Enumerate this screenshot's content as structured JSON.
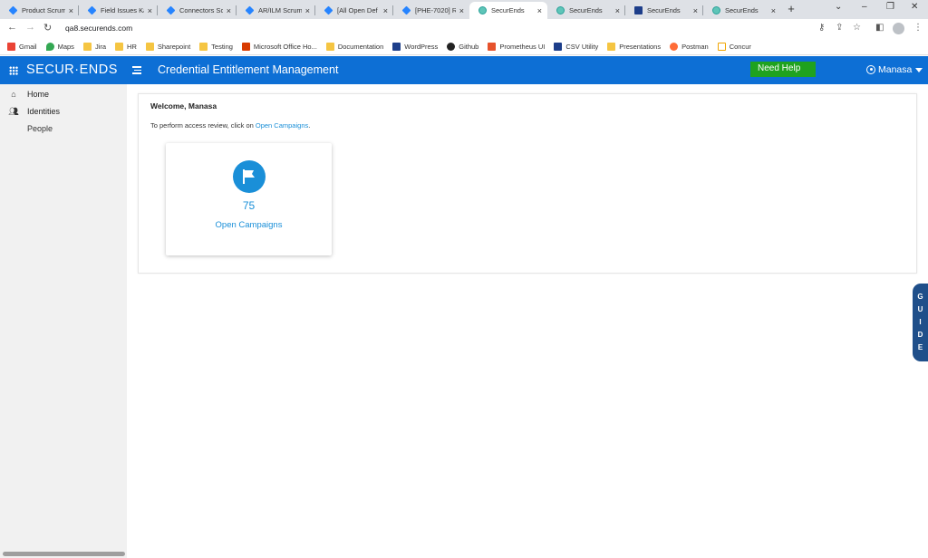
{
  "browser": {
    "tabs": [
      {
        "label": "Product Scrum",
        "favicon": "jira-icon",
        "active": false
      },
      {
        "label": "Field Issues Ka",
        "favicon": "jira-icon",
        "active": false
      },
      {
        "label": "Connectors Sc",
        "favicon": "jira-icon",
        "active": false
      },
      {
        "label": "AR/ILM Scrum",
        "favicon": "jira-icon",
        "active": false
      },
      {
        "label": "[All Open Def",
        "favicon": "jira-icon",
        "active": false
      },
      {
        "label": "[PHE-7020] Re",
        "favicon": "jira-icon",
        "active": false
      },
      {
        "label": "SecurEnds",
        "favicon": "securends-icon",
        "active": true
      },
      {
        "label": "SecurEnds",
        "favicon": "securends-icon",
        "active": false
      },
      {
        "label": "SecurEnds",
        "favicon": "securends-s-icon",
        "active": false
      },
      {
        "label": "SecurEnds",
        "favicon": "securends-icon",
        "active": false
      }
    ],
    "new_tab": "+",
    "close_glyph": "×",
    "window_controls": {
      "tab_search": "⌄",
      "minimize": "–",
      "restore": "❐",
      "close": "✕"
    },
    "url": "qa8.securends.com",
    "bookmarks": [
      {
        "label": "Gmail",
        "icon": "gmail-icon"
      },
      {
        "label": "Maps",
        "icon": "maps-icon"
      },
      {
        "label": "Jira",
        "icon": "folder-icon"
      },
      {
        "label": "HR",
        "icon": "folder-icon"
      },
      {
        "label": "Sharepoint",
        "icon": "folder-icon"
      },
      {
        "label": "Testing",
        "icon": "folder-icon"
      },
      {
        "label": "Microsoft Office Ho...",
        "icon": "office-icon"
      },
      {
        "label": "Documentation",
        "icon": "folder-icon"
      },
      {
        "label": "WordPress",
        "icon": "securends-s-icon"
      },
      {
        "label": "Github",
        "icon": "github-icon"
      },
      {
        "label": "Prometheus UI",
        "icon": "prometheus-icon"
      },
      {
        "label": "CSV Utility",
        "icon": "securends-s-icon"
      },
      {
        "label": "Presentations",
        "icon": "folder-icon"
      },
      {
        "label": "Postman",
        "icon": "postman-icon"
      },
      {
        "label": "Concur",
        "icon": "concur-icon"
      }
    ]
  },
  "app": {
    "logo": "SECUR·ENDS",
    "title": "Credential Entitlement Management",
    "need_help": "Need Help",
    "user_name": "Manasa",
    "colors": {
      "header": "#0d6fd5",
      "accent": "#1a8fd8",
      "help": "#1fa21f",
      "guide": "#1f4f8a"
    }
  },
  "sidebar": {
    "items": [
      {
        "label": "Home",
        "icon": "home-icon"
      },
      {
        "label": "Identities",
        "icon": "people-icon"
      }
    ],
    "sub_items": [
      {
        "label": "People"
      }
    ]
  },
  "main": {
    "welcome": "Welcome, Manasa",
    "intro_prefix": "To perform access review, click on ",
    "intro_link": "Open Campaigns",
    "intro_suffix": ".",
    "card": {
      "count": "75",
      "label": "Open Campaigns",
      "icon": "flag-icon"
    }
  },
  "guide": {
    "letters": [
      "G",
      "U",
      "I",
      "D",
      "E"
    ]
  }
}
